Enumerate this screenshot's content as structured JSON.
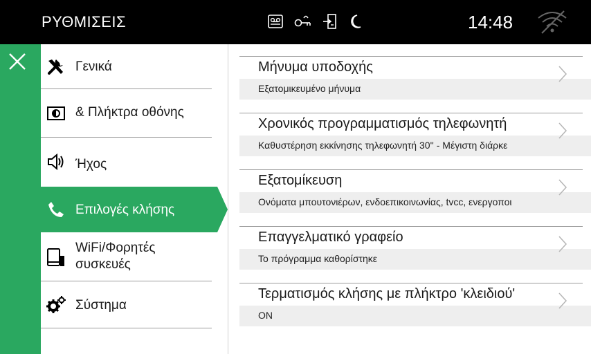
{
  "header": {
    "title": "ΡΥΘΜΙΣΕΙΣ",
    "time": "14:48",
    "status_icons": [
      "voicemail-icon",
      "key-icon",
      "door-exit-icon",
      "moon-icon"
    ],
    "wifi_icon": "wifi-off-icon"
  },
  "menu": {
    "items": [
      {
        "label": "Γενικά",
        "icon": "wrench-icon"
      },
      {
        "label": "& Πλήκτρα οθόνης",
        "icon": "screen-keys-icon"
      },
      {
        "label": "Ήχος",
        "icon": "speaker-icon"
      },
      {
        "label": "Επιλογές κλήσης",
        "icon": "phone-icon",
        "selected": true
      },
      {
        "label": "WiFi/Φορητές",
        "label2": "συσκευές",
        "icon": "mobile-devices-icon"
      },
      {
        "label": "Σύστημα",
        "icon": "gears-icon"
      }
    ]
  },
  "options": [
    {
      "title": "Μήνυμα υποδοχής",
      "value": "Εξατομικευμένο μήνυμα"
    },
    {
      "title": "Χρονικός προγραμματισμός τηλεφωνητή",
      "value": "Καθυστέρηση εκκίνησης τηλεφωνητή 30'' - Μέγιστη διάρκε"
    },
    {
      "title": "Εξατομίκευση",
      "value": "Ονόματα μπουτονιέρων, ενδοεπικοινωνίας, tvcc, ενεργοποι"
    },
    {
      "title": "Επαγγελματικό γραφείο",
      "value": "Το πρόγραμμα καθορίστηκε"
    },
    {
      "title": "Τερματισμός κλήσης με πλήκτρο 'κλειδιού'",
      "value": "ON"
    }
  ],
  "colors": {
    "accent": "#2aa860",
    "topbar": "#000000"
  }
}
